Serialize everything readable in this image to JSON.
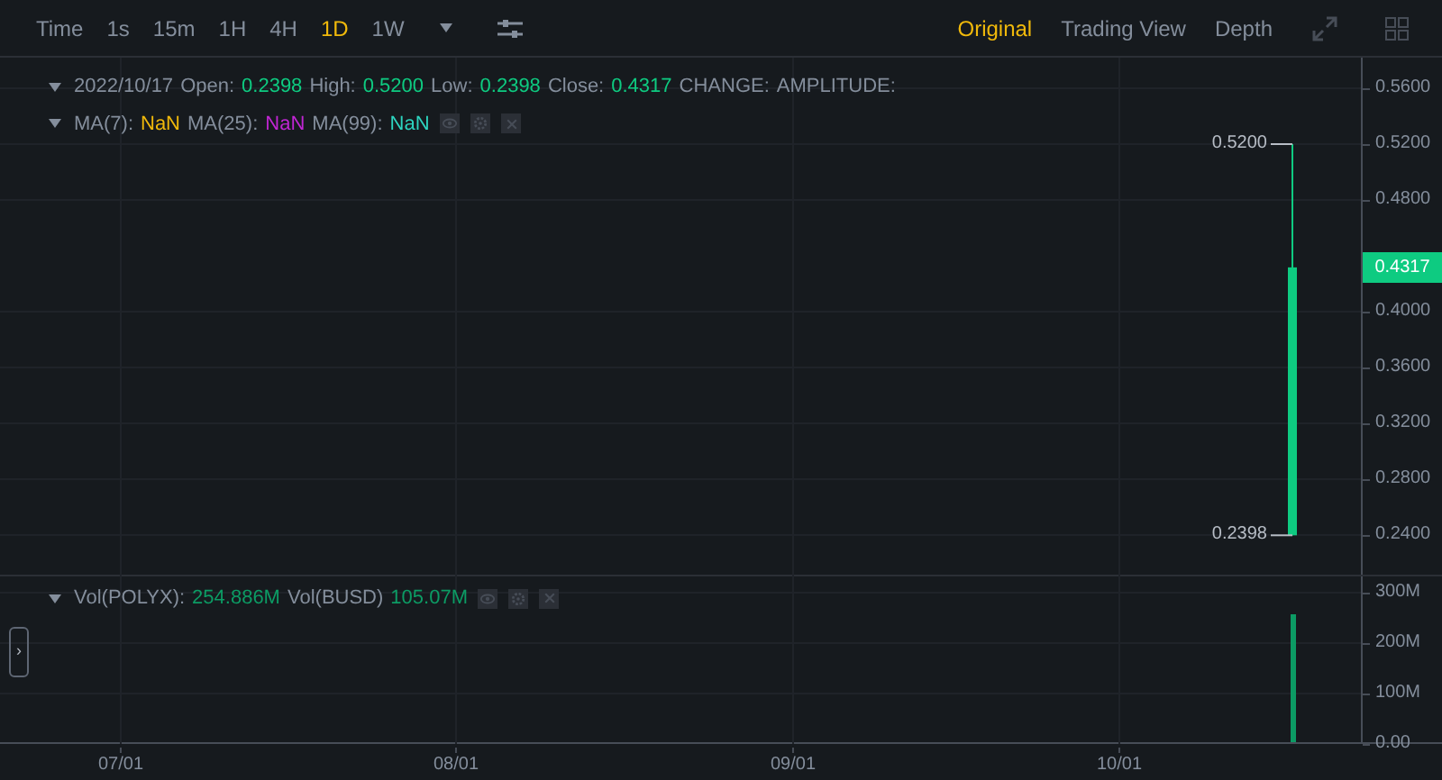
{
  "toolbar": {
    "intervals": [
      {
        "label": "Time",
        "selected": false
      },
      {
        "label": "1s",
        "selected": false
      },
      {
        "label": "15m",
        "selected": false
      },
      {
        "label": "1H",
        "selected": false
      },
      {
        "label": "4H",
        "selected": false
      },
      {
        "label": "1D",
        "selected": true
      },
      {
        "label": "1W",
        "selected": false
      }
    ],
    "views": [
      {
        "label": "Original",
        "selected": true
      },
      {
        "label": "Trading View",
        "selected": false
      },
      {
        "label": "Depth",
        "selected": false
      }
    ]
  },
  "price_pane": {
    "legend": {
      "date": "2022/10/17",
      "fields": [
        {
          "label": "Open:",
          "value": "0.2398"
        },
        {
          "label": "High:",
          "value": "0.5200"
        },
        {
          "label": "Low:",
          "value": "0.2398"
        },
        {
          "label": "Close:",
          "value": "0.4317"
        },
        {
          "label": "CHANGE:"
        },
        {
          "label": "AMPLITUDE:"
        }
      ]
    },
    "indicators": [
      {
        "label": "MA(7):",
        "value": "NaN",
        "color": "#f0b90b"
      },
      {
        "label": "MA(25):",
        "value": "NaN",
        "color": "#c026d3"
      },
      {
        "label": "MA(99):",
        "value": "NaN",
        "color": "#2dd4bf"
      }
    ],
    "high_label": "0.5200",
    "low_label": "0.2398",
    "last_price": "0.4317",
    "ticks": [
      "0.5600",
      "0.5200",
      "0.4800",
      "0.4000",
      "0.3600",
      "0.3200",
      "0.2800",
      "0.2400"
    ]
  },
  "volume_pane": {
    "legend": [
      {
        "label": "Vol(POLYX):",
        "value": "254.886M"
      },
      {
        "label": "Vol(BUSD)",
        "value": "105.07M"
      }
    ],
    "bar": {
      "level": 0.85
    },
    "ticks": [
      "300M",
      "200M",
      "100M",
      "0.00"
    ]
  },
  "collapse_toggle": "›",
  "date_axis": [
    "07/01",
    "08/01",
    "09/01",
    "10/01"
  ]
}
